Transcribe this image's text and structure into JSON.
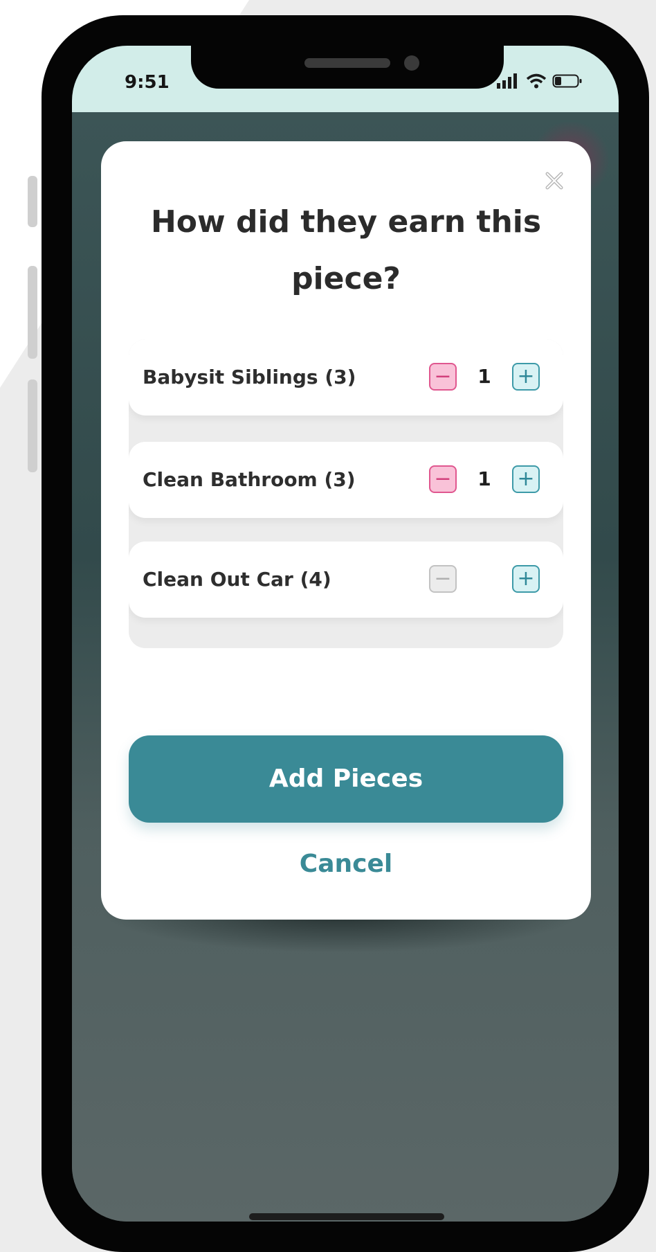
{
  "status_bar": {
    "time": "9:51",
    "icons": [
      "cellular-signal-icon",
      "wifi-icon",
      "battery-icon"
    ]
  },
  "modal": {
    "close_icon": "close-icon",
    "title": "How did they earn this piece?",
    "items": [
      {
        "label": "Babysit Siblings (3)",
        "quantity": "1",
        "minus_enabled": true
      },
      {
        "label": "Clean Bathroom (3)",
        "quantity": "1",
        "minus_enabled": true
      },
      {
        "label": "Clean Out Car (4)",
        "quantity": "",
        "minus_enabled": false
      }
    ],
    "minus_symbol": "−",
    "plus_symbol": "+",
    "primary_button_label": "Add Pieces",
    "cancel_label": "Cancel"
  },
  "colors": {
    "accent": "#3a8a96",
    "status_bar_bg": "#d2ede9",
    "minus_active": "#e0578f",
    "plus": "#3d9aa8"
  }
}
